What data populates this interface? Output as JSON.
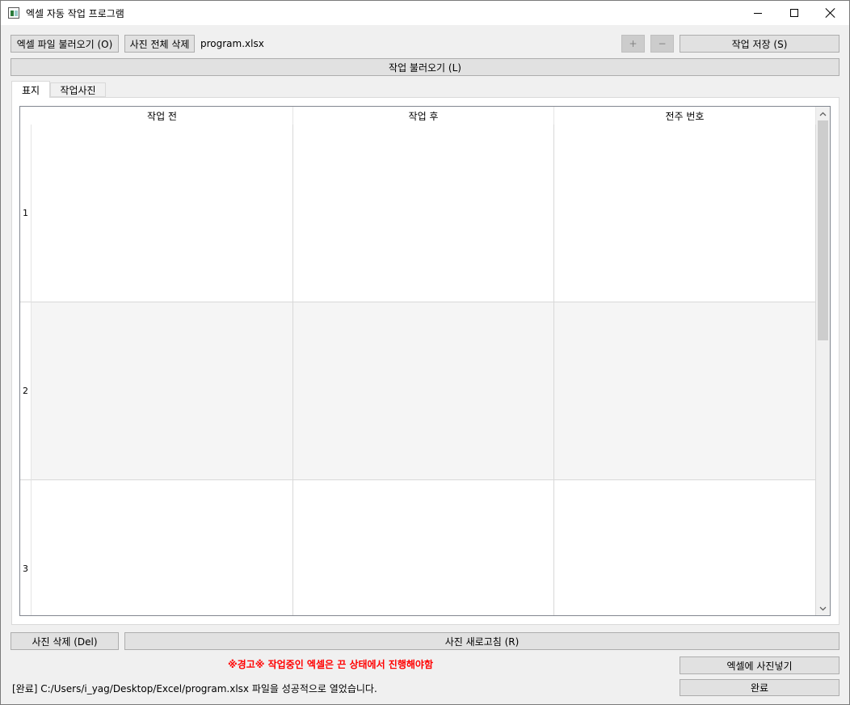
{
  "window": {
    "title": "엑셀 자동 작업 프로그램"
  },
  "toolbar": {
    "open_excel_label": "엑셀 파일 불러오기 (O)",
    "delete_all_photos_label": "사진 전체 삭제",
    "filename": "program.xlsx",
    "plus_label": "+",
    "minus_label": "−",
    "save_work_label": "작업 저장 (S)",
    "load_work_label": "작업 불러오기 (L)"
  },
  "tabs": [
    {
      "label": "표지",
      "active": true
    },
    {
      "label": "작업사진",
      "active": false
    }
  ],
  "table": {
    "columns": [
      "작업 전",
      "작업 후",
      "전주 번호"
    ],
    "rows": [
      {
        "index": "1",
        "cells": [
          "",
          "",
          ""
        ]
      },
      {
        "index": "2",
        "cells": [
          "",
          "",
          ""
        ]
      },
      {
        "index": "3",
        "cells": [
          "",
          "",
          ""
        ]
      }
    ]
  },
  "bottom": {
    "delete_photo_label": "사진 삭제 (Del)",
    "refresh_photos_label": "사진 새로고침 (R)",
    "warning_text": "※경고※ 작업중인 엑셀은 끈 상태에서 진행해야함",
    "insert_photos_label": "엑셀에 사진넣기",
    "status_text": "[완료] C:/Users/i_yag/Desktop/Excel/program.xlsx 파일을 성공적으로 열었습니다.",
    "done_label": "완료"
  },
  "icons": {
    "app": "excel-app-icon",
    "minimize": "minimize-icon",
    "maximize": "maximize-icon",
    "close": "close-icon",
    "scroll_up": "chevron-up-icon",
    "scroll_down": "chevron-down-icon"
  },
  "colors": {
    "warning": "#ff0000",
    "button_bg": "#e1e1e1",
    "disabled_button_bg": "#cccccc"
  }
}
